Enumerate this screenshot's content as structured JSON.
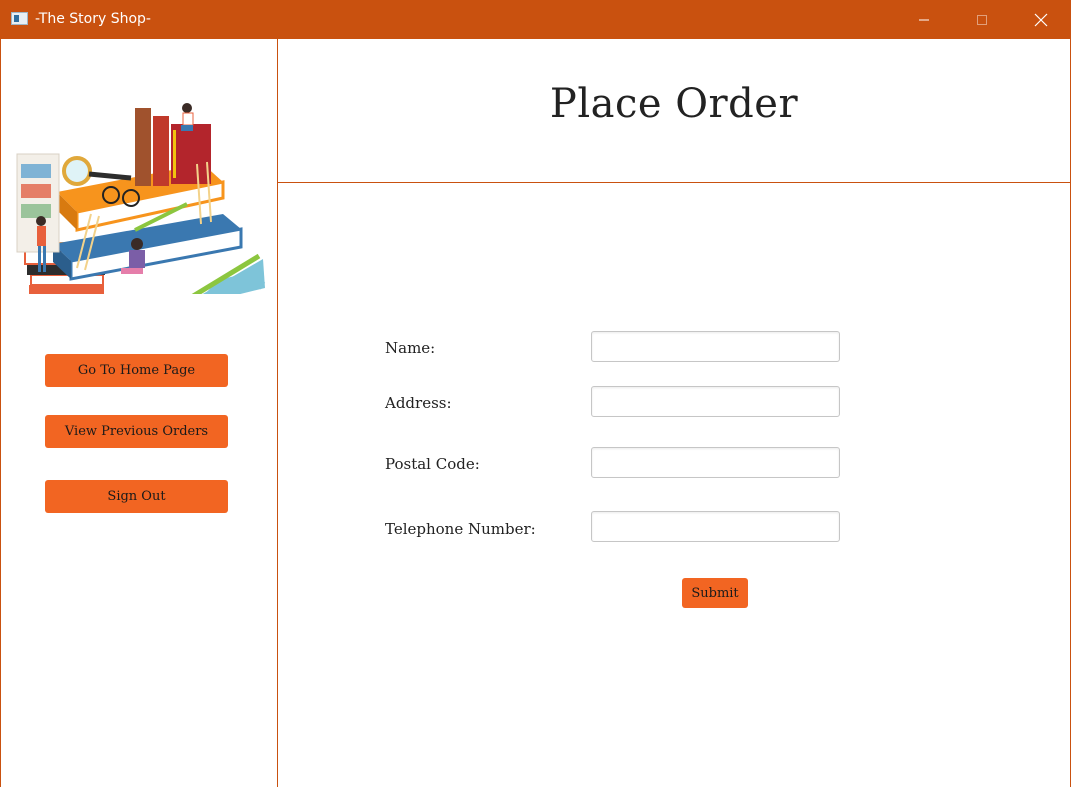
{
  "window": {
    "title": "-The Story Shop-"
  },
  "sidebar": {
    "buttons": [
      {
        "label": "Go To Home Page"
      },
      {
        "label": "View Previous Orders"
      },
      {
        "label": "Sign Out"
      }
    ]
  },
  "main": {
    "heading": "Place Order",
    "form": {
      "fields": [
        {
          "label": "Name:",
          "value": ""
        },
        {
          "label": "Address:",
          "value": ""
        },
        {
          "label": "Postal Code:",
          "value": ""
        },
        {
          "label": "Telephone Number:",
          "value": ""
        }
      ],
      "submit_label": "Submit"
    }
  },
  "colors": {
    "titlebar": "#c9510f",
    "accent_button": "#f26522",
    "divider": "#c9510f"
  },
  "icons": {
    "app": "app-window-icon",
    "minimize": "minimize-icon",
    "maximize": "maximize-icon",
    "close": "close-icon"
  }
}
